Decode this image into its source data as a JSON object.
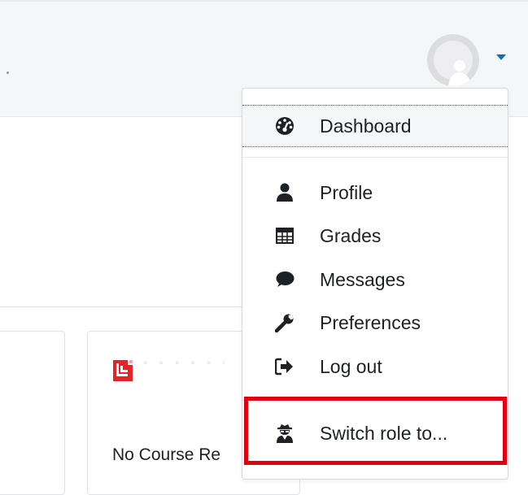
{
  "user_menu": {
    "items": [
      {
        "label": "Dashboard",
        "icon": "tachometer-icon"
      },
      {
        "label": "Profile",
        "icon": "user-icon"
      },
      {
        "label": "Grades",
        "icon": "table-icon"
      },
      {
        "label": "Messages",
        "icon": "comment-icon"
      },
      {
        "label": "Preferences",
        "icon": "wrench-icon"
      },
      {
        "label": "Log out",
        "icon": "sign-out-icon"
      },
      {
        "label": "Switch role to...",
        "icon": "user-secret-icon"
      }
    ]
  },
  "course_card": {
    "text": "No Course Re"
  },
  "colors": {
    "accent": "#0f6cbf",
    "highlight": "#e0000f",
    "course_logo": "#e3242b"
  }
}
